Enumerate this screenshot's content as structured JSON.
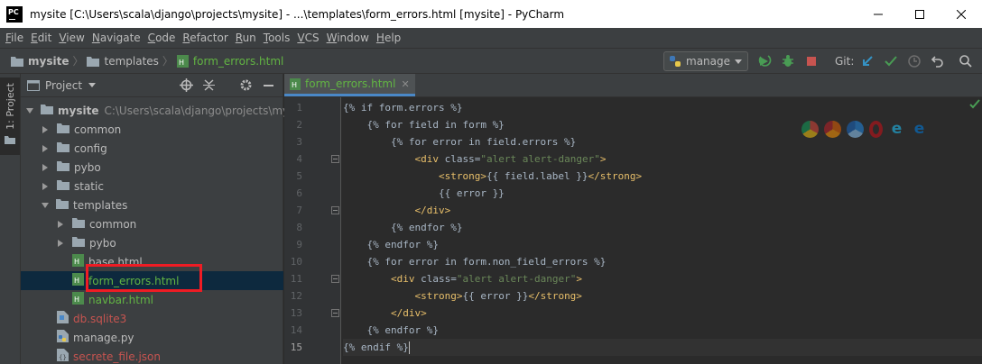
{
  "window": {
    "title": "mysite [C:\\Users\\scala\\django\\projects\\mysite] - ...\\templates\\form_errors.html [mysite] - PyCharm",
    "app_icon": "pycharm-logo",
    "logo_text": "PC"
  },
  "menu": [
    {
      "mnemonic": "F",
      "rest": "ile"
    },
    {
      "mnemonic": "E",
      "rest": "dit"
    },
    {
      "mnemonic": "V",
      "rest": "iew"
    },
    {
      "mnemonic": "N",
      "rest": "avigate"
    },
    {
      "mnemonic": "C",
      "rest": "ode"
    },
    {
      "mnemonic": "R",
      "rest": "efactor"
    },
    {
      "mnemonic": "R",
      "rest": "un"
    },
    {
      "mnemonic": "T",
      "rest": "ools"
    },
    {
      "mnemonic": "V",
      "rest": "CS"
    },
    {
      "mnemonic": "W",
      "rest": "indow"
    },
    {
      "mnemonic": "H",
      "rest": "elp"
    }
  ],
  "breadcrumb": {
    "root": "mysite",
    "folder": "templates",
    "file": "form_errors.html"
  },
  "toolbar": {
    "run_config": "manage",
    "git_label": "Git:",
    "icons": [
      "rerun-icon",
      "debug-icon",
      "stop-icon",
      "vcs-update-icon",
      "vcs-commit-icon",
      "history-icon",
      "rollback-icon",
      "search-icon"
    ]
  },
  "tool_stripe": {
    "project_tab": "1: Project"
  },
  "project_panel": {
    "title": "Project",
    "tree": [
      {
        "label": "mysite",
        "extra": "C:\\Users\\scala\\django\\projects\\mysite",
        "type": "folder",
        "depth": 0,
        "expanded": true,
        "bold": true
      },
      {
        "label": "common",
        "type": "folder",
        "depth": 1,
        "expanded": false
      },
      {
        "label": "config",
        "type": "folder",
        "depth": 1,
        "expanded": false
      },
      {
        "label": "pybo",
        "type": "folder",
        "depth": 1,
        "expanded": false
      },
      {
        "label": "static",
        "type": "folder",
        "depth": 1,
        "expanded": false
      },
      {
        "label": "templates",
        "type": "folder",
        "depth": 1,
        "expanded": true
      },
      {
        "label": "common",
        "type": "folder",
        "depth": 2,
        "expanded": false
      },
      {
        "label": "pybo",
        "type": "folder",
        "depth": 2,
        "expanded": false
      },
      {
        "label": "base.html",
        "type": "html",
        "depth": 2,
        "status": "normal"
      },
      {
        "label": "form_errors.html",
        "type": "html",
        "depth": 2,
        "status": "added",
        "selected": true
      },
      {
        "label": "navbar.html",
        "type": "html",
        "depth": 2,
        "status": "added"
      },
      {
        "label": "db.sqlite3",
        "type": "db",
        "depth": 1,
        "status": "ignored"
      },
      {
        "label": "manage.py",
        "type": "py",
        "depth": 1,
        "status": "normal"
      },
      {
        "label": "secrete_file.json",
        "type": "json",
        "depth": 1,
        "status": "ignored"
      }
    ]
  },
  "editor": {
    "tab_label": "form_errors.html",
    "current_line": 15,
    "lines": [
      [
        {
          "t": "{% if form.errors %}",
          "c": "plain"
        }
      ],
      [
        {
          "t": "    {% for field in form %}",
          "c": "plain"
        }
      ],
      [
        {
          "t": "        {% for error in field.errors %}",
          "c": "plain"
        }
      ],
      [
        {
          "t": "            ",
          "c": "plain"
        },
        {
          "t": "<div ",
          "c": "tag"
        },
        {
          "t": "class=",
          "c": "plain"
        },
        {
          "t": "\"alert alert-danger\"",
          "c": "str"
        },
        {
          "t": ">",
          "c": "tag"
        }
      ],
      [
        {
          "t": "                ",
          "c": "plain"
        },
        {
          "t": "<strong>",
          "c": "tag"
        },
        {
          "t": "{{ field.label }}",
          "c": "plain"
        },
        {
          "t": "</strong>",
          "c": "tag"
        }
      ],
      [
        {
          "t": "                {{ error }}",
          "c": "plain"
        }
      ],
      [
        {
          "t": "            ",
          "c": "plain"
        },
        {
          "t": "</div>",
          "c": "tag"
        }
      ],
      [
        {
          "t": "        {% endfor %}",
          "c": "plain"
        }
      ],
      [
        {
          "t": "    {% endfor %}",
          "c": "plain"
        }
      ],
      [
        {
          "t": "    {% for error in form.non_field_errors %}",
          "c": "plain"
        }
      ],
      [
        {
          "t": "        ",
          "c": "plain"
        },
        {
          "t": "<div ",
          "c": "tag"
        },
        {
          "t": "class=",
          "c": "plain"
        },
        {
          "t": "\"alert alert-danger\"",
          "c": "str"
        },
        {
          "t": ">",
          "c": "tag"
        }
      ],
      [
        {
          "t": "            ",
          "c": "plain"
        },
        {
          "t": "<strong>",
          "c": "tag"
        },
        {
          "t": "{{ error }}",
          "c": "plain"
        },
        {
          "t": "</strong>",
          "c": "tag"
        }
      ],
      [
        {
          "t": "        ",
          "c": "plain"
        },
        {
          "t": "</div>",
          "c": "tag"
        }
      ],
      [
        {
          "t": "    {% endfor %}",
          "c": "plain"
        }
      ],
      [
        {
          "t": "{% endif %}",
          "c": "plain"
        }
      ]
    ],
    "fold_lines": [
      4,
      7,
      11,
      13
    ],
    "browser_icons": [
      "chrome-icon",
      "firefox-icon",
      "safari-icon",
      "opera-icon",
      "ie-icon",
      "edge-icon"
    ]
  },
  "colors": {
    "bg_editor": "#2b2b2b",
    "bg_panel": "#3c3f41",
    "selection": "#0d293e",
    "added_file": "#62b543",
    "ignored_file": "#c75450",
    "tag": "#e8bf6a",
    "string": "#6a8759",
    "annotation_box": "#ee1c24"
  }
}
